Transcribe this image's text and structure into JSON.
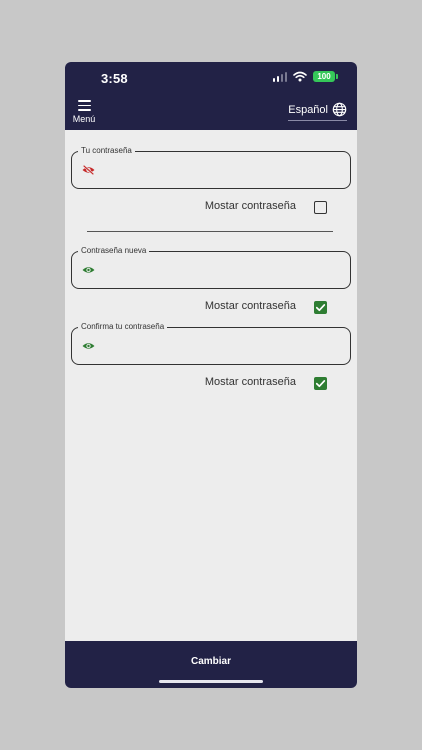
{
  "status_bar": {
    "time": "3:58",
    "battery": "100"
  },
  "header": {
    "menu_label": "Menú",
    "language_label": "Español"
  },
  "form": {
    "current_password": {
      "label": "Tu contraseña",
      "value": "",
      "icon": "eye-off-icon",
      "icon_color": "#c62828"
    },
    "current_show": {
      "label": "Mostar contraseña",
      "checked": false
    },
    "new_password": {
      "label": "Contraseña nueva",
      "value": "",
      "icon": "eye-icon",
      "icon_color": "#2e7d32"
    },
    "new_show": {
      "label": "Mostar contraseña",
      "checked": true
    },
    "confirm_password": {
      "label": "Confirma tu contraseña",
      "value": "",
      "icon": "eye-icon",
      "icon_color": "#2e7d32"
    },
    "confirm_show": {
      "label": "Mostar contraseña",
      "checked": true
    }
  },
  "footer": {
    "submit_label": "Cambiar"
  },
  "colors": {
    "bar": "#222246",
    "background": "#ededed",
    "check": "#2e7d32",
    "battery": "#35c759"
  }
}
